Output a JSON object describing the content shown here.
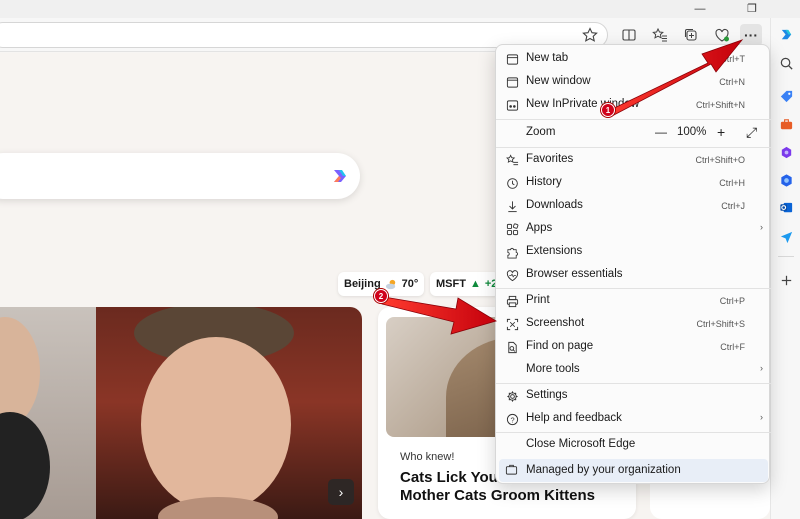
{
  "window": {
    "minimize": "—",
    "restore": "❐"
  },
  "toolbar": {
    "more_label": "···"
  },
  "page": {
    "weather": {
      "city": "Beijing",
      "temp": "70°"
    },
    "stock": {
      "ticker": "MSFT",
      "change": "+2."
    },
    "card": {
      "kicker": "Who knew!",
      "title": "Cats Lick You t Just Like Mother Cats Groom Kittens"
    },
    "next_label": "›"
  },
  "menu": {
    "items": [
      {
        "label": "New tab",
        "shortcut": "Ctrl+T"
      },
      {
        "label": "New window",
        "shortcut": "Ctrl+N"
      },
      {
        "label": "New InPrivate window",
        "shortcut": "Ctrl+Shift+N"
      },
      {
        "label": "Zoom"
      },
      {
        "label": "Favorites",
        "shortcut": "Ctrl+Shift+O"
      },
      {
        "label": "History",
        "shortcut": "Ctrl+H"
      },
      {
        "label": "Downloads",
        "shortcut": "Ctrl+J"
      },
      {
        "label": "Apps"
      },
      {
        "label": "Extensions"
      },
      {
        "label": "Browser essentials"
      },
      {
        "label": "Print",
        "shortcut": "Ctrl+P"
      },
      {
        "label": "Screenshot",
        "shortcut": "Ctrl+Shift+S"
      },
      {
        "label": "Find on page",
        "shortcut": "Ctrl+F"
      },
      {
        "label": "More tools"
      },
      {
        "label": "Settings"
      },
      {
        "label": "Help and feedback"
      },
      {
        "label": "Close Microsoft Edge"
      },
      {
        "label": "Managed by your organization"
      }
    ],
    "zoom": {
      "minus": "—",
      "value": "100%",
      "plus": "+",
      "fullscreen": "⤢"
    },
    "submenu_arrow": "›"
  },
  "annotations": {
    "badge1": "1",
    "badge2": "2"
  },
  "colors": {
    "accent": "#0067c0",
    "arrow": "#e3000f",
    "managed_bg": "#e8eef7"
  }
}
